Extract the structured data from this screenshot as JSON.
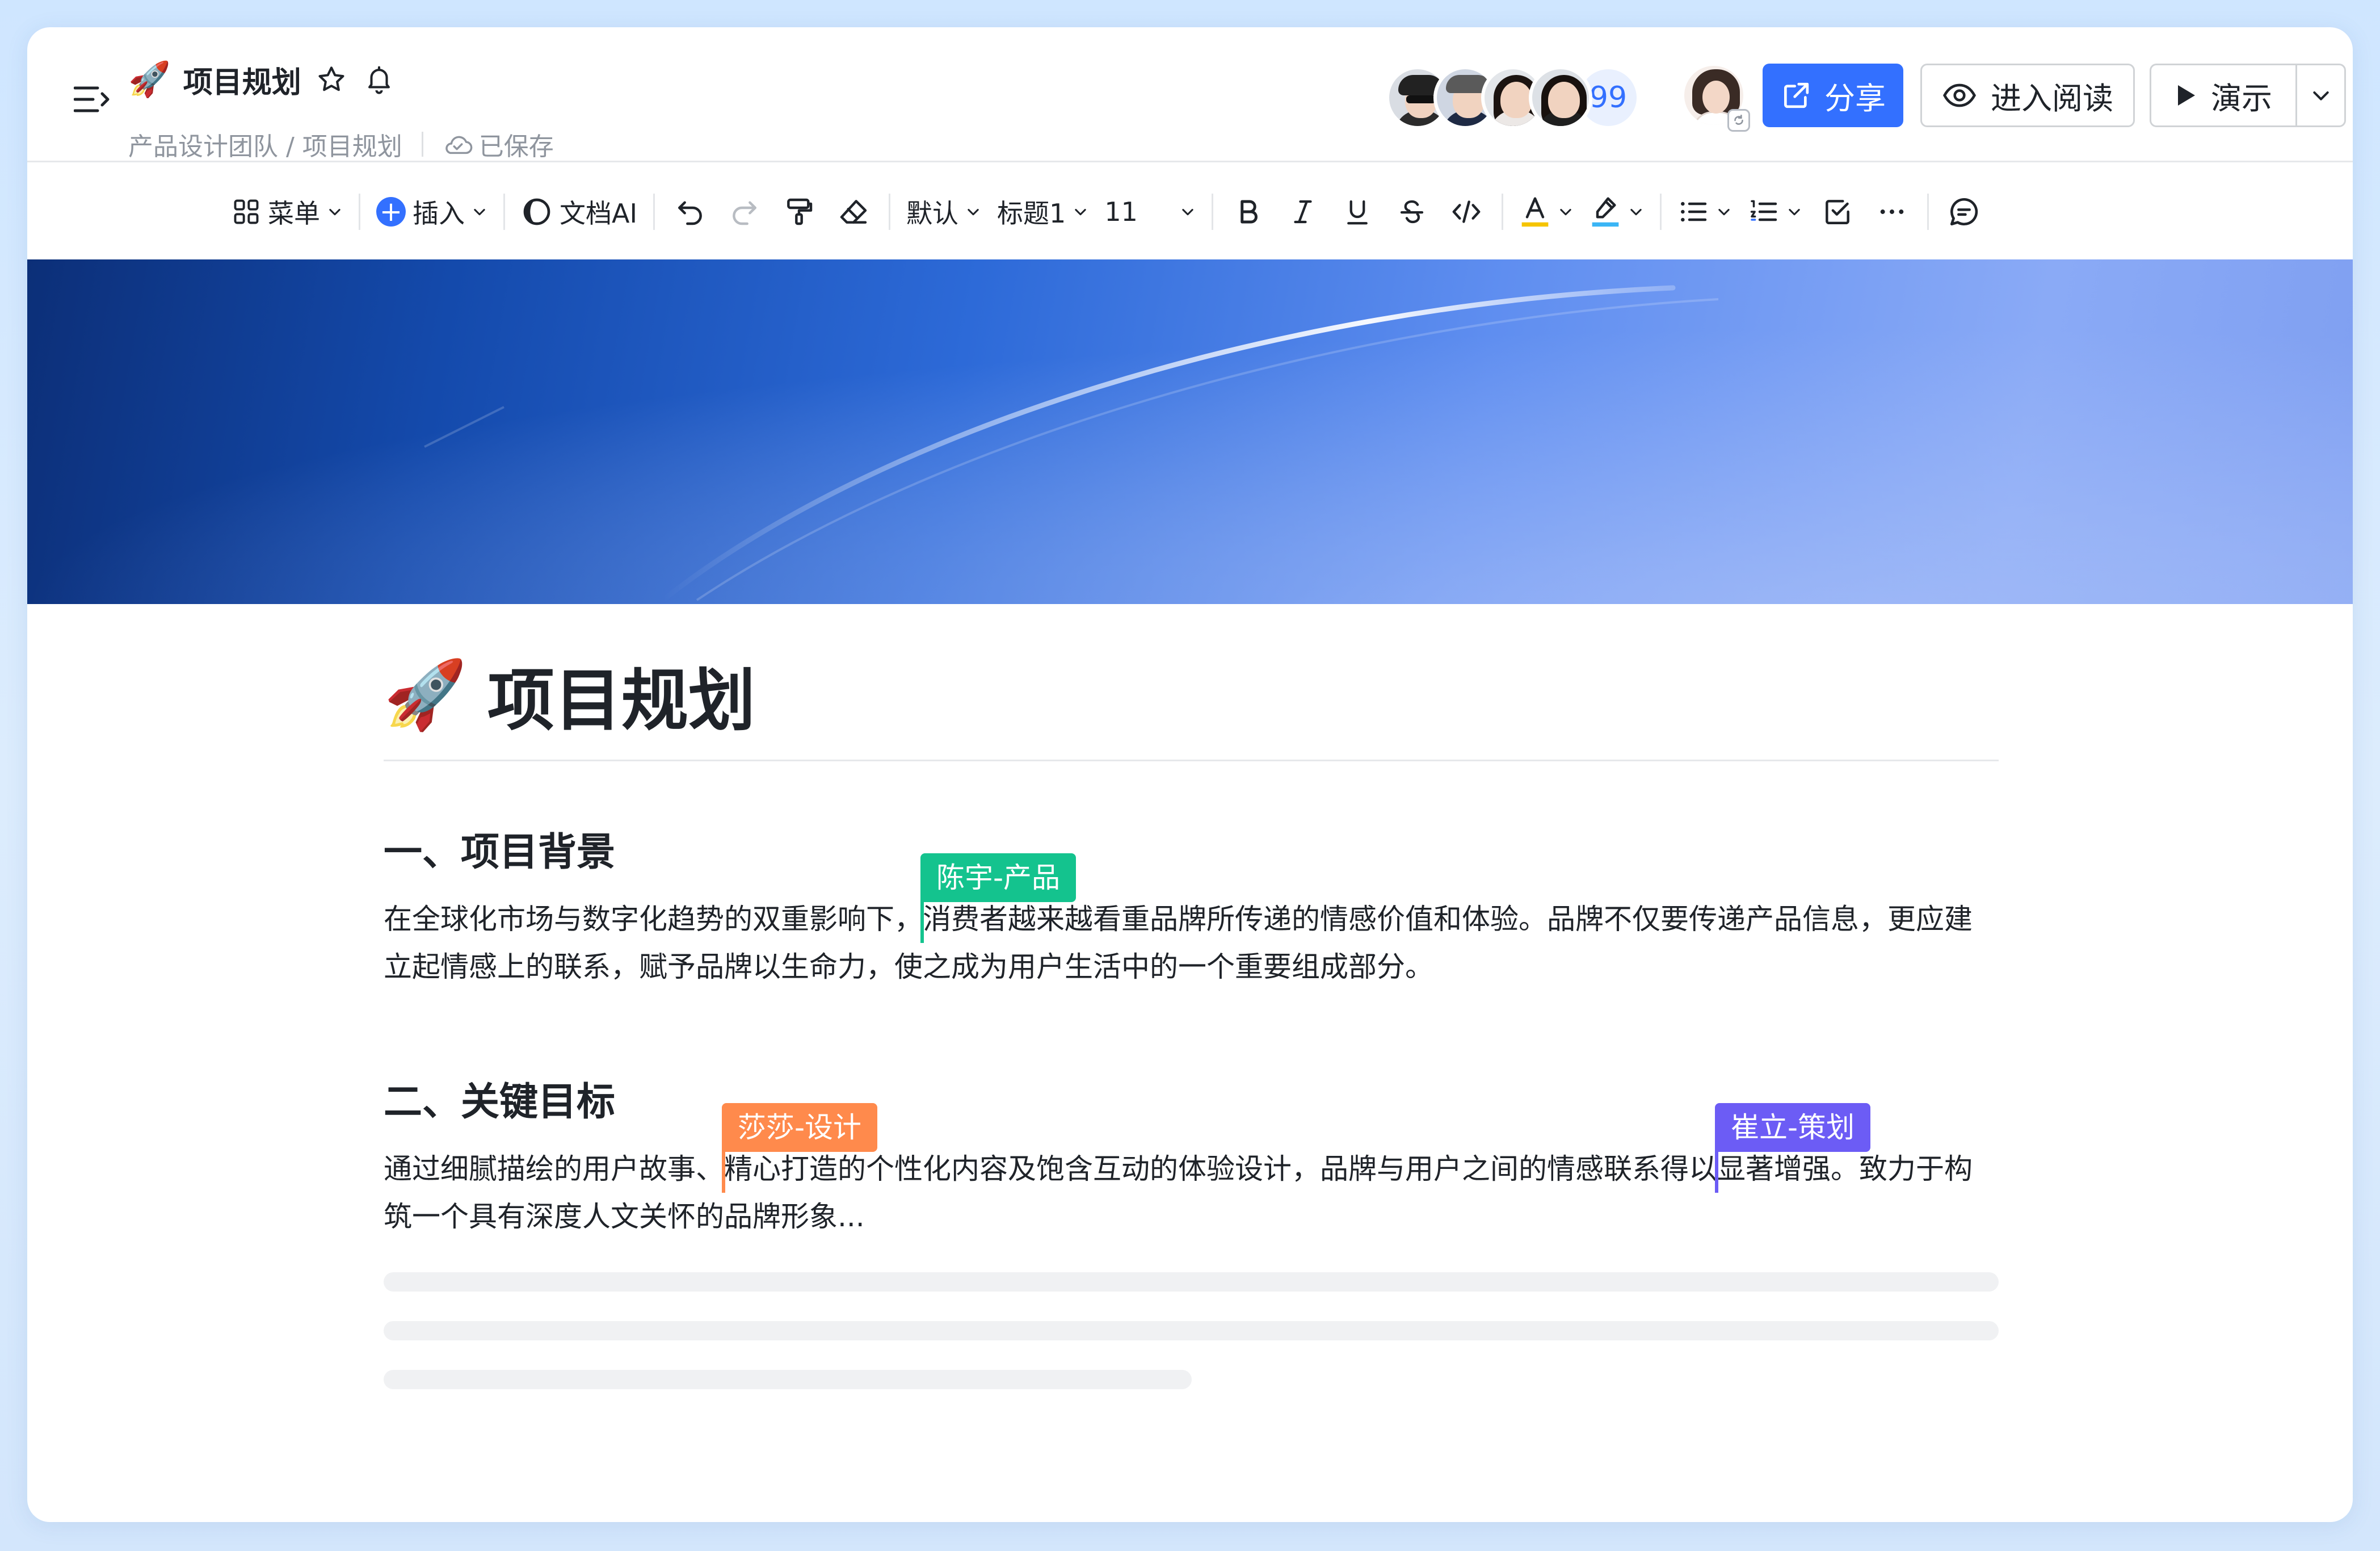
{
  "app": {
    "title_emoji": "🚀",
    "title": "项目规划",
    "breadcrumb": "产品设计团队 / 项目规划",
    "save_status": "已保存"
  },
  "collaborators": {
    "overflow_count": "99",
    "avatars": [
      {
        "hair": "#222222",
        "body": "#2b2b2b",
        "bg": "#d9dde3"
      },
      {
        "hair": "#5a5a5a",
        "body": "#1e2a44",
        "bg": "#cfd6e2"
      },
      {
        "hair": "#1c1411",
        "body": "#ece8e6",
        "bg": "#e3e6ea"
      },
      {
        "hair": "#18110e",
        "body": "#1f1f1f",
        "bg": "#dde1e6"
      }
    ]
  },
  "actions": {
    "share": "分享",
    "read_mode": "进入阅读",
    "present": "演示"
  },
  "toolbar": {
    "menu": "菜单",
    "insert": "插入",
    "ai": "文档AI",
    "font_style": "默认",
    "heading": "标题1",
    "font_size": "11"
  },
  "document": {
    "emoji": "🚀",
    "title": "项目规划",
    "sections": [
      {
        "heading": "一、项目背景",
        "text_before": "在全球化市场与数字化趋势的双重影响下，",
        "text_after": "消费者越来越看重品牌所传递的情感价值和体验。品牌不仅要传递产品信息，更应建立起情感上的联系，赋予品牌以生命力，使之成为用户生活中的一个重要组成部分。"
      },
      {
        "heading": "二、关键目标",
        "text_1": "通过细腻描绘的用户故事、",
        "text_2": "精心打造的个性化内容及饱含互动的体验设计，品牌与用户之间的情感联系得以",
        "text_3": "显著增强。致力于构筑一个具有深度人文关怀的品牌形象..."
      }
    ]
  },
  "cursors": [
    {
      "name": "陈宇-产品",
      "color": "#14c38e"
    },
    {
      "name": "莎莎-设计",
      "color": "#ff8a4c"
    },
    {
      "name": "崔立-策划",
      "color": "#6c5cf5"
    }
  ],
  "colors": {
    "accent": "#3370ff",
    "text_color_underline": "#f5c400",
    "highlight_underline": "#3ab5f5"
  }
}
